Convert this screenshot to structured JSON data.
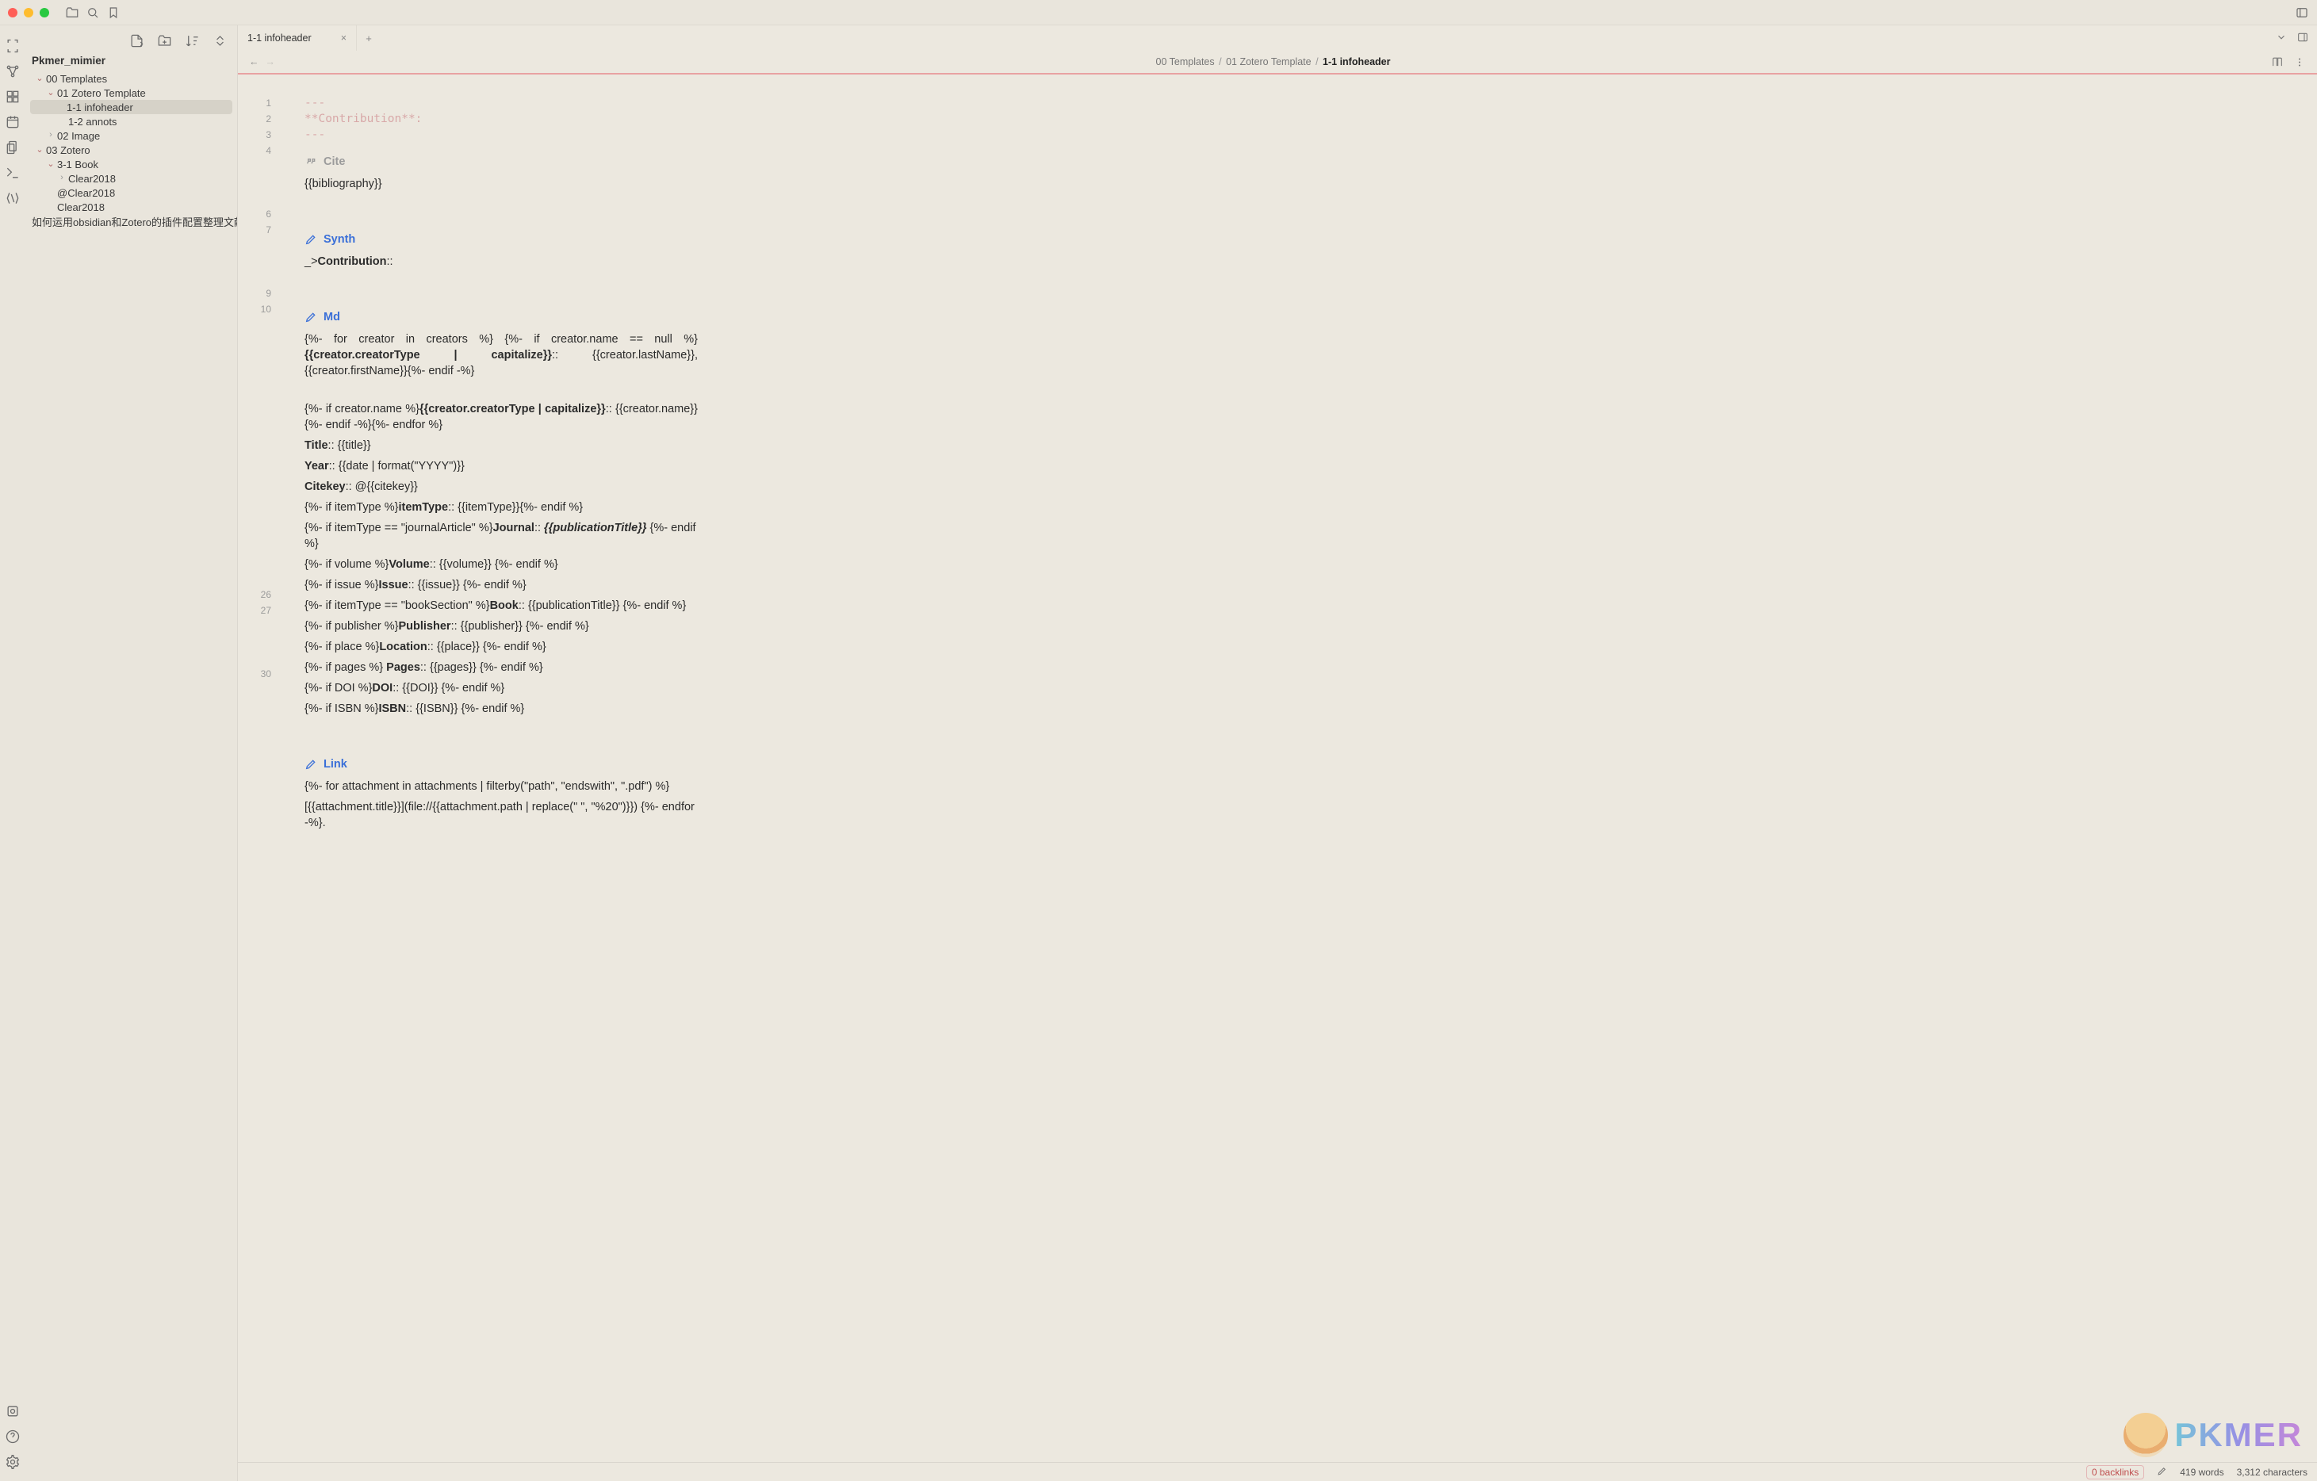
{
  "tab": {
    "title": "1-1 infoheader"
  },
  "crumbs": {
    "seg1": "00 Templates",
    "seg2": "01 Zotero Template",
    "cur": "1-1 infoheader"
  },
  "vault": "Pkmer_mimier",
  "tree": [
    {
      "d": 0,
      "type": "folder",
      "open": true,
      "label": "00 Templates"
    },
    {
      "d": 1,
      "type": "folder",
      "open": true,
      "label": "01 Zotero Template"
    },
    {
      "d": 2,
      "type": "file",
      "label": "1-1 infoheader",
      "active": true
    },
    {
      "d": 2,
      "type": "file",
      "label": "1-2 annots"
    },
    {
      "d": 1,
      "type": "folder",
      "open": false,
      "gray": true,
      "label": "02 Image"
    },
    {
      "d": 0,
      "type": "folder",
      "open": true,
      "label": "03 Zotero"
    },
    {
      "d": 1,
      "type": "folder",
      "open": true,
      "label": "3-1 Book"
    },
    {
      "d": 2,
      "type": "folder",
      "open": false,
      "gray": true,
      "label": "Clear2018"
    },
    {
      "d": 1,
      "type": "file",
      "label": "@Clear2018"
    },
    {
      "d": 1,
      "type": "file",
      "label": "Clear2018"
    },
    {
      "d": 0,
      "type": "file",
      "label": "如何运用obsidian和Zotero的插件配置整理文献管理实现..."
    }
  ],
  "gutter": [
    "1",
    "2",
    "3",
    "4",
    "",
    "",
    "",
    "6",
    "7",
    "",
    "",
    "",
    "9",
    "10",
    "",
    "",
    "",
    "",
    "",
    "",
    "",
    "",
    "",
    "",
    "",
    "",
    "",
    "",
    "",
    "",
    "",
    "26",
    "27",
    "",
    "",
    "",
    "30"
  ],
  "code": {
    "l1": "---",
    "l2": "**Contribution**:",
    "l3": "---",
    "citeHd": "Cite",
    "cite1": "{{bibliography}}",
    "synthHd": "Synth",
    "synth1a": "_>",
    "synth1b": "Contribution",
    "synth1c": "::",
    "mdHd": "Md",
    "md1a": "{%- for creator in creators %} {%- if creator.name == null %} ",
    "md1b": "{{creator.creatorType | capitalize}}",
    "md1c": ":: {{creator.lastName}}, {{creator.firstName}}{%- endif -%}",
    "md2a": "{%-  if  creator.name  %}",
    "md2b": "{{creator.creatorType  |  capitalize}}",
    "md2c": "::  {{creator.name}}{%- endif -%}{%- endfor %}",
    "md3a": "Title",
    "md3b": ":: {{title}}",
    "md4a": "Year",
    "md4b": ":: {{date | format(\"YYYY\")}}",
    "md5a": "Citekey",
    "md5b": ":: @{{citekey}}",
    "md6a": "{%- if itemType %}",
    "md6b": "itemType",
    "md6c": ":: {{itemType}}{%- endif %}",
    "md7a": "{%- if itemType == \"journalArticle\" %}",
    "md7b": "Journal",
    "md7c": ":: ",
    "md7d": "{{publicationTitle}}",
    "md7e": " {%- endif %}",
    "md8a": "{%- if volume %}",
    "md8b": "Volume",
    "md8c": ":: {{volume}} {%- endif %}",
    "md9a": "{%- if issue %}",
    "md9b": "Issue",
    "md9c": ":: {{issue}} {%- endif %}",
    "md10a": "{%- if itemType == \"bookSection\" %}",
    "md10b": "Book",
    "md10c": ":: {{publicationTitle}} {%- endif %}",
    "md11a": "{%- if publisher %}",
    "md11b": "Publisher",
    "md11c": ":: {{publisher}} {%- endif %}",
    "md12a": "{%- if place %}",
    "md12b": "Location",
    "md12c": ":: {{place}} {%- endif %}",
    "md13a": "{%- if pages %} ",
    "md13b": "Pages",
    "md13c": ":: {{pages}} {%- endif %}",
    "md14a": "{%- if DOI %}",
    "md14b": "DOI",
    "md14c": ":: {{DOI}} {%- endif %}",
    "md15a": "{%- if ISBN %}",
    "md15b": "ISBN",
    "md15c": ":: {{ISBN}} {%- endif %}",
    "linkHd": "Link",
    "link1": "{%- for attachment in attachments | filterby(\"path\", \"endswith\", \".pdf\") %}",
    "link2": "[{{attachment.title}}](file://{{attachment.path | replace(\" \", \"%20\")}}) {%- endfor -%}."
  },
  "status": {
    "backlinks": "0 backlinks",
    "words": "419 words",
    "chars": "3,312 characters"
  },
  "wm": "PKMER"
}
